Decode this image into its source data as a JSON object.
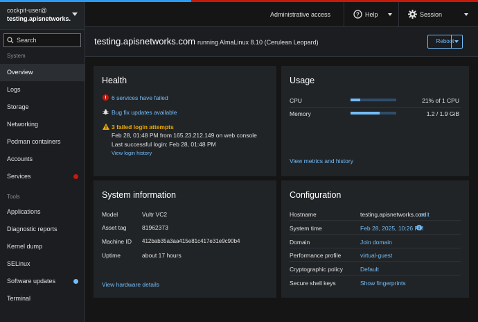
{
  "sidebar": {
    "user": "cockpit-user@",
    "host": "testing.apisnetworks.com",
    "search_label": "Search",
    "sections": [
      {
        "title": "System",
        "items": [
          {
            "label": "Overview"
          },
          {
            "label": "Logs"
          },
          {
            "label": "Storage"
          },
          {
            "label": "Networking"
          },
          {
            "label": "Podman containers"
          },
          {
            "label": "Accounts"
          },
          {
            "label": "Services"
          }
        ]
      },
      {
        "title": "Tools",
        "items": [
          {
            "label": "Applications"
          },
          {
            "label": "Diagnostic reports"
          },
          {
            "label": "Kernel dump"
          },
          {
            "label": "SELinux"
          },
          {
            "label": "Software updates"
          },
          {
            "label": "Terminal"
          }
        ]
      }
    ]
  },
  "masthead": {
    "admin_label": "Administrative access",
    "help_label": "Help",
    "session_label": "Session"
  },
  "page": {
    "hostname": "testing.apisnetworks.com",
    "os": "running AlmaLinux 8.10 (Cerulean Leopard)",
    "reboot_label": "Reboot"
  },
  "health": {
    "title": "Health",
    "services_failed": "6 services have failed",
    "bugfix": "Bug fix updates available",
    "login_failed_title": "3 failed login attempts",
    "login_failed_detail": "Feb 28, 01:48 PM from 165.23.212.149 on web console",
    "last_login": "Last successful login: Feb 28, 01:48 PM",
    "login_history_link": "View login history"
  },
  "usage": {
    "title": "Usage",
    "cpu_label": "CPU",
    "cpu_value": "21% of 1 CPU",
    "cpu_fraction": 0.21,
    "memory_label": "Memory",
    "memory_value": "1.2 / 1.9 GiB",
    "memory_fraction": 0.63,
    "metrics_link": "View metrics and history"
  },
  "sysinfo": {
    "title": "System information",
    "rows": [
      {
        "label": "Model",
        "value": "Vultr VC2"
      },
      {
        "label": "Asset tag",
        "value": "81962373"
      },
      {
        "label": "Machine ID",
        "value": "412bab35a3aa415e81c417e31e9c90b4"
      },
      {
        "label": "Uptime",
        "value": "about 17 hours"
      }
    ],
    "hardware_link": "View hardware details"
  },
  "config": {
    "title": "Configuration",
    "hostname_label": "Hostname",
    "hostname_value": "testing.apisnetworks.com",
    "hostname_edit": "edit",
    "time_label": "System time",
    "time_value": "Feb 28, 2025, 10:26 PM",
    "domain_label": "Domain",
    "domain_value": "Join domain",
    "perf_label": "Performance profile",
    "perf_value": "virtual-guest",
    "crypto_label": "Cryptographic policy",
    "crypto_value": "Default",
    "ssh_label": "Secure shell keys",
    "ssh_value": "Show fingerprints"
  },
  "colors": {
    "link": "#73bcf7",
    "danger": "#c9190b",
    "warning": "#f0ab00"
  }
}
